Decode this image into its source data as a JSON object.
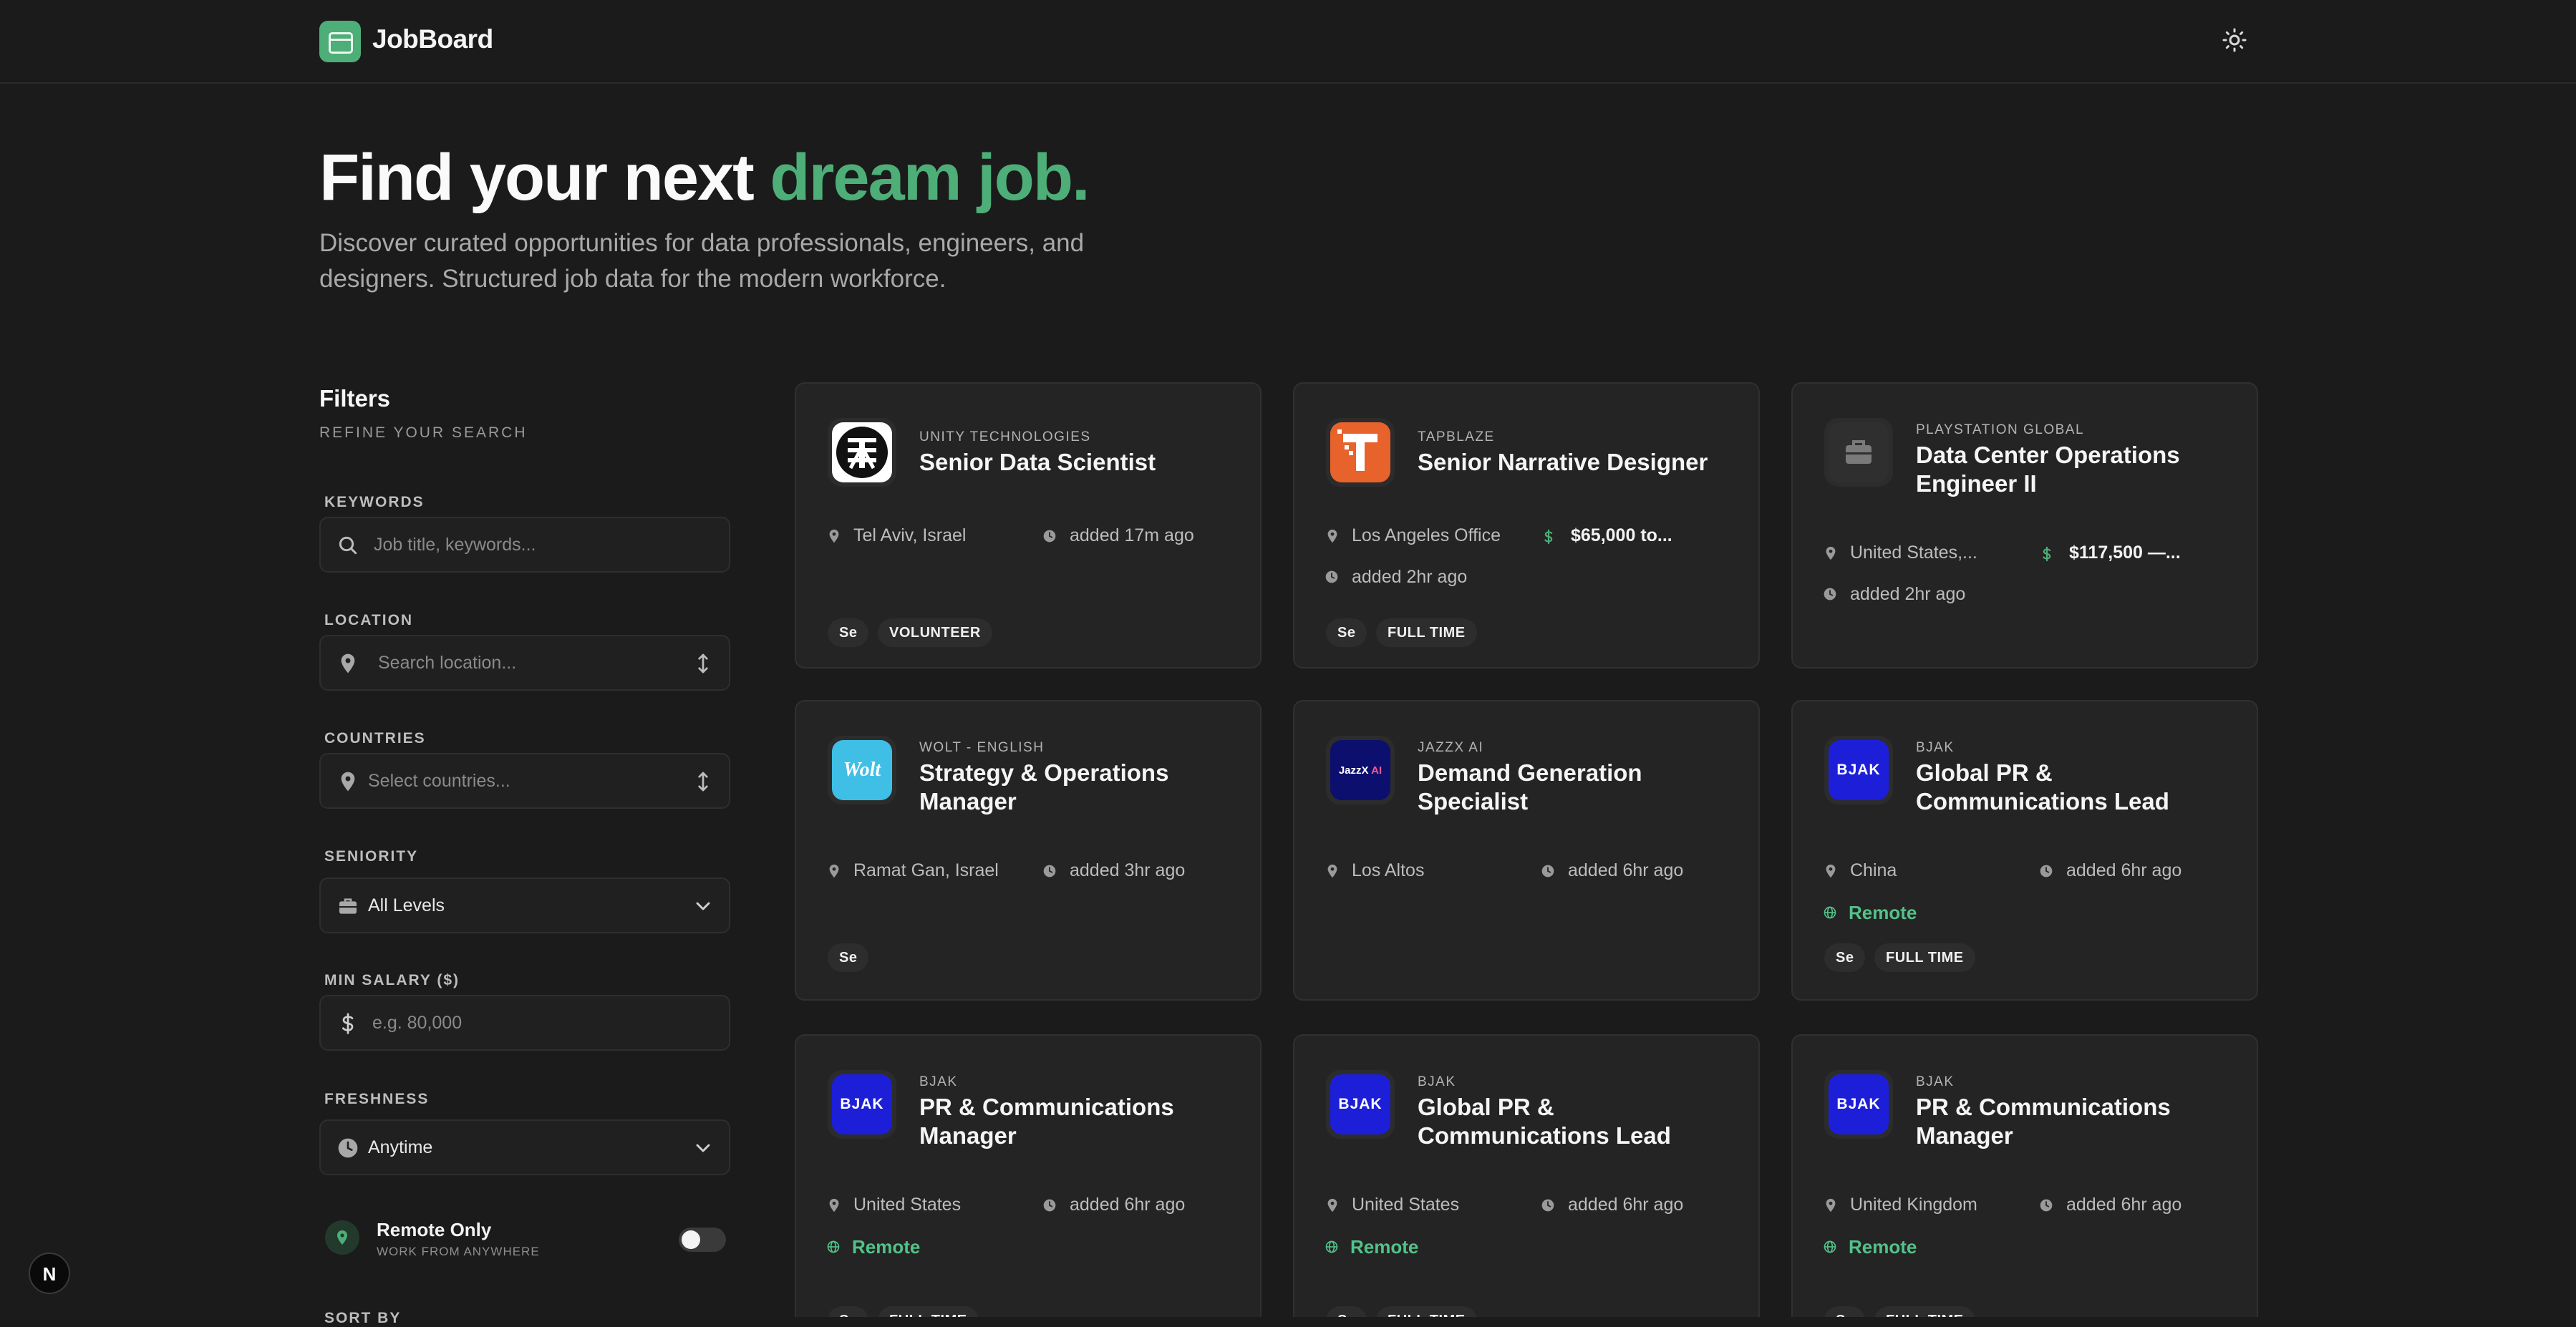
{
  "app": {
    "brand": "JobBoard"
  },
  "hero": {
    "title_prefix": "Find your next ",
    "title_accent": "dream job.",
    "subtitle": "Discover curated opportunities for data professionals, engineers, and designers. Structured job data for the modern workforce."
  },
  "filters": {
    "title": "Filters",
    "subtitle": "REFINE YOUR SEARCH",
    "keywords": {
      "label": "KEYWORDS",
      "placeholder": "Job title, keywords..."
    },
    "location": {
      "label": "LOCATION",
      "placeholder": "Search location..."
    },
    "countries": {
      "label": "COUNTRIES",
      "placeholder": "Select countries..."
    },
    "seniority": {
      "label": "SENIORITY",
      "value": "All Levels"
    },
    "min_salary": {
      "label": "MIN SALARY ($)",
      "placeholder": "e.g. 80,000"
    },
    "freshness": {
      "label": "FRESHNESS",
      "value": "Anytime"
    },
    "remote": {
      "title": "Remote Only",
      "subtitle": "WORK FROM ANYWHERE",
      "enabled": false
    },
    "sort_label": "SORT BY"
  },
  "jobs": [
    {
      "company": "UNITY TECHNOLOGIES",
      "title": "Senior Data Scientist",
      "location": "Tel Aviv, Israel",
      "added": "added 17m ago",
      "salary": "",
      "remote": "",
      "tags": [
        "Se",
        "VOLUNTEER"
      ],
      "logo": "unity"
    },
    {
      "company": "TAPBLAZE",
      "title": "Senior Narrative Designer",
      "location": "Los Angeles Office",
      "added": "added 2hr ago",
      "salary": "$65,000 to...",
      "remote": "",
      "tags": [
        "Se",
        "FULL TIME"
      ],
      "logo": "tapblaze"
    },
    {
      "company": "PLAYSTATION GLOBAL",
      "title": "Data Center Operations Engineer II",
      "location": "United States,...",
      "added": "added 2hr ago",
      "salary": "$117,500 —...",
      "remote": "",
      "tags": [],
      "logo": "briefcase"
    },
    {
      "company": "WOLT - ENGLISH",
      "title": "Strategy & Operations Manager",
      "location": "Ramat Gan, Israel",
      "added": "added 3hr ago",
      "salary": "",
      "remote": "",
      "tags": [
        "Se"
      ],
      "logo": "wolt"
    },
    {
      "company": "JAZZX AI",
      "title": "Demand Generation Specialist",
      "location": "Los Altos",
      "added": "added 6hr ago",
      "salary": "",
      "remote": "",
      "tags": [],
      "logo": "jazzx"
    },
    {
      "company": "BJAK",
      "title": "Global PR & Communications Lead",
      "location": "China",
      "added": "added 6hr ago",
      "salary": "",
      "remote": "Remote",
      "tags": [
        "Se",
        "FULL TIME"
      ],
      "logo": "bjak"
    },
    {
      "company": "BJAK",
      "title": "PR & Communications Manager",
      "location": "United States",
      "added": "added 6hr ago",
      "salary": "",
      "remote": "Remote",
      "tags": [
        "Se",
        "FULL TIME"
      ],
      "logo": "bjak"
    },
    {
      "company": "BJAK",
      "title": "Global PR & Communications Lead",
      "location": "United States",
      "added": "added 6hr ago",
      "salary": "",
      "remote": "Remote",
      "tags": [
        "Se",
        "FULL TIME"
      ],
      "logo": "bjak"
    },
    {
      "company": "BJAK",
      "title": "PR & Communications Manager",
      "location": "United Kingdom",
      "added": "added 6hr ago",
      "salary": "",
      "remote": "Remote",
      "tags": [
        "Se",
        "FULL TIME"
      ],
      "logo": "bjak"
    }
  ],
  "logos": {
    "wolt": "Wolt",
    "jazzx_a": "JazzX",
    "jazzx_b": " AI",
    "bjak": "BJAK"
  },
  "colors": {
    "accent": "#4eae78",
    "remote": "#52c289",
    "background": "#1b1b1b",
    "card": "#242424",
    "bjak": "#1d1fd8",
    "wolt": "#3fbfe6",
    "tapblaze": "#e8622c"
  },
  "next_badge": "N"
}
